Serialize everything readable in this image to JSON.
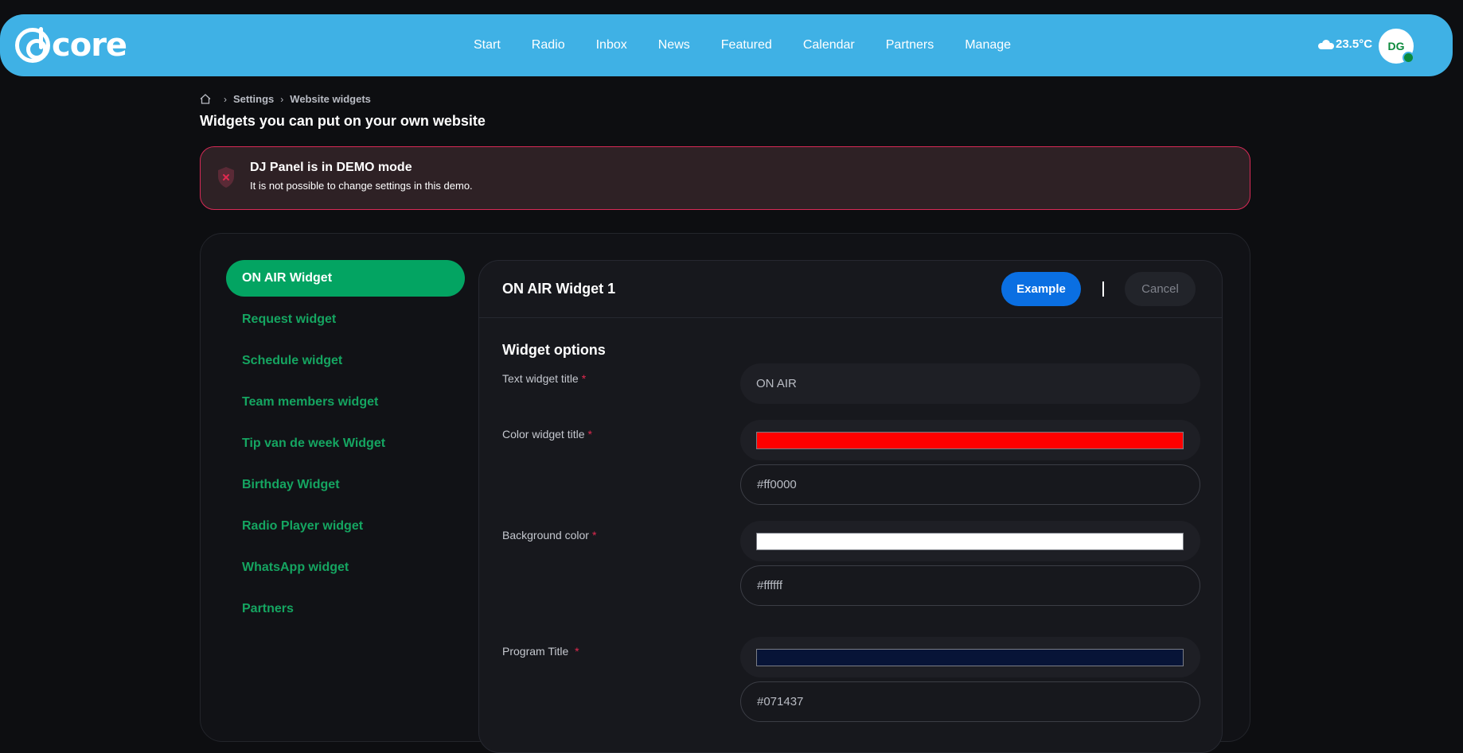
{
  "app": {
    "logo_text": "core",
    "nav": [
      "Start",
      "Radio",
      "Inbox",
      "News",
      "Featured",
      "Calendar",
      "Partners",
      "Manage"
    ],
    "weather": "23.5°C",
    "weather_icon": "cloud-icon",
    "avatar_initials": "DG"
  },
  "breadcrumb": [
    "Settings",
    "Website widgets"
  ],
  "page_title": "Widgets you can put on your own website",
  "alert": {
    "title": "DJ Panel is in DEMO mode",
    "text": "It is not possible to change settings in this demo.",
    "border_color": "#d72a56"
  },
  "sidebar": {
    "active_index": 0,
    "items": [
      "ON AIR Widget",
      "Request widget",
      "Schedule widget",
      "Team members widget",
      "Tip van de week Widget",
      "Birthday Widget",
      "Radio Player widget",
      "WhatsApp widget",
      "Partners"
    ]
  },
  "widget": {
    "title": "ON AIR Widget 1",
    "example_label": "Example",
    "cancel_label": "Cancel",
    "section_title": "Widget options",
    "fields": {
      "text_title": {
        "label": "Text widget title",
        "value": "ON AIR"
      },
      "color_title": {
        "label": "Color widget title",
        "value": "#ff0000"
      },
      "background": {
        "label": "Background color",
        "value": "#ffffff"
      },
      "program_title": {
        "label": "Program Title ",
        "value": "#071437"
      }
    },
    "required_mark": "*"
  },
  "colors": {
    "accent_blue": "#3fb1e5",
    "accent_green": "#03a462",
    "primary_button": "#0a6fe2"
  }
}
